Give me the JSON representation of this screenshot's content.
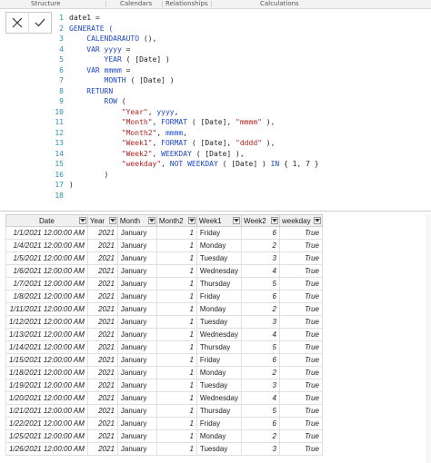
{
  "ribbon": {
    "sections": [
      "Structure",
      "Calendars",
      "Relationships",
      "Calculations"
    ]
  },
  "formula_bar": {
    "cancel_icon": "close-icon",
    "commit_icon": "checkmark-icon",
    "line_numbers": [
      "1",
      "2",
      "3",
      "4",
      "5",
      "6",
      "7",
      "8",
      "9",
      "10",
      "11",
      "12",
      "13",
      "14",
      "15",
      "16",
      "17",
      "18"
    ]
  },
  "code": [
    [
      {
        "t": "date1 =",
        "c": "txt"
      }
    ],
    [
      {
        "t": "GENERATE (",
        "c": "kw"
      }
    ],
    [
      {
        "t": "    ",
        "c": "txt"
      },
      {
        "t": "CALENDARAUTO",
        "c": "kw"
      },
      {
        "t": " (),",
        "c": "txt"
      }
    ],
    [
      {
        "t": "    ",
        "c": "txt"
      },
      {
        "t": "VAR",
        "c": "kw"
      },
      {
        "t": " ",
        "c": "txt"
      },
      {
        "t": "yyyy",
        "c": "kw"
      },
      {
        "t": " =",
        "c": "txt"
      }
    ],
    [
      {
        "t": "        ",
        "c": "txt"
      },
      {
        "t": "YEAR",
        "c": "kw"
      },
      {
        "t": " ( [Date] )",
        "c": "txt"
      }
    ],
    [
      {
        "t": "    ",
        "c": "txt"
      },
      {
        "t": "VAR",
        "c": "kw"
      },
      {
        "t": " ",
        "c": "txt"
      },
      {
        "t": "mmmm",
        "c": "kw"
      },
      {
        "t": " =",
        "c": "txt"
      }
    ],
    [
      {
        "t": "        ",
        "c": "txt"
      },
      {
        "t": "MONTH",
        "c": "kw"
      },
      {
        "t": " ( [Date] )",
        "c": "txt"
      }
    ],
    [
      {
        "t": "    ",
        "c": "txt"
      },
      {
        "t": "RETURN",
        "c": "kw"
      }
    ],
    [
      {
        "t": "        ",
        "c": "txt"
      },
      {
        "t": "ROW",
        "c": "kw"
      },
      {
        "t": " (",
        "c": "txt"
      }
    ],
    [
      {
        "t": "            ",
        "c": "txt"
      },
      {
        "t": "\"Year\"",
        "c": "str"
      },
      {
        "t": ", ",
        "c": "txt"
      },
      {
        "t": "yyyy",
        "c": "kw"
      },
      {
        "t": ",",
        "c": "txt"
      }
    ],
    [
      {
        "t": "            ",
        "c": "txt"
      },
      {
        "t": "\"Month\"",
        "c": "str"
      },
      {
        "t": ", ",
        "c": "txt"
      },
      {
        "t": "FORMAT",
        "c": "kw"
      },
      {
        "t": " ( [Date], ",
        "c": "txt"
      },
      {
        "t": "\"mmmm\"",
        "c": "str"
      },
      {
        "t": " ),",
        "c": "txt"
      }
    ],
    [
      {
        "t": "            ",
        "c": "txt"
      },
      {
        "t": "\"Month2\"",
        "c": "str"
      },
      {
        "t": ", ",
        "c": "txt"
      },
      {
        "t": "mmmm",
        "c": "kw"
      },
      {
        "t": ",",
        "c": "txt"
      }
    ],
    [
      {
        "t": "            ",
        "c": "txt"
      },
      {
        "t": "\"Week1\"",
        "c": "str"
      },
      {
        "t": ", ",
        "c": "txt"
      },
      {
        "t": "FORMAT",
        "c": "kw"
      },
      {
        "t": " ( [Date], ",
        "c": "txt"
      },
      {
        "t": "\"dddd\"",
        "c": "str"
      },
      {
        "t": " ),",
        "c": "txt"
      }
    ],
    [
      {
        "t": "            ",
        "c": "txt"
      },
      {
        "t": "\"Week2\"",
        "c": "str"
      },
      {
        "t": ", ",
        "c": "txt"
      },
      {
        "t": "WEEKDAY",
        "c": "kw"
      },
      {
        "t": " ( [Date] ),",
        "c": "txt"
      }
    ],
    [
      {
        "t": "            ",
        "c": "txt"
      },
      {
        "t": "\"weekday\"",
        "c": "str"
      },
      {
        "t": ", ",
        "c": "txt"
      },
      {
        "t": "NOT",
        "c": "kw"
      },
      {
        "t": " ",
        "c": "txt"
      },
      {
        "t": "WEEKDAY",
        "c": "kw"
      },
      {
        "t": " ( [Date] ) ",
        "c": "txt"
      },
      {
        "t": "IN",
        "c": "kw"
      },
      {
        "t": " { 1, 7 }",
        "c": "txt"
      }
    ],
    [
      {
        "t": "        )",
        "c": "txt"
      }
    ],
    [
      {
        "t": ")",
        "c": "txt"
      }
    ],
    [
      {
        "t": "",
        "c": "txt"
      }
    ]
  ],
  "table": {
    "columns": [
      "Date",
      "Year",
      "Month",
      "Month2",
      "Week1",
      "Week2",
      "weekday"
    ],
    "rows": [
      [
        "1/1/2021 12:00:00 AM",
        "2021",
        "January",
        "1",
        "Friday",
        "6",
        "True"
      ],
      [
        "1/4/2021 12:00:00 AM",
        "2021",
        "January",
        "1",
        "Monday",
        "2",
        "True"
      ],
      [
        "1/5/2021 12:00:00 AM",
        "2021",
        "January",
        "1",
        "Tuesday",
        "3",
        "True"
      ],
      [
        "1/6/2021 12:00:00 AM",
        "2021",
        "January",
        "1",
        "Wednesday",
        "4",
        "True"
      ],
      [
        "1/7/2021 12:00:00 AM",
        "2021",
        "January",
        "1",
        "Thursday",
        "5",
        "True"
      ],
      [
        "1/8/2021 12:00:00 AM",
        "2021",
        "January",
        "1",
        "Friday",
        "6",
        "True"
      ],
      [
        "1/11/2021 12:00:00 AM",
        "2021",
        "January",
        "1",
        "Monday",
        "2",
        "True"
      ],
      [
        "1/12/2021 12:00:00 AM",
        "2021",
        "January",
        "1",
        "Tuesday",
        "3",
        "True"
      ],
      [
        "1/13/2021 12:00:00 AM",
        "2021",
        "January",
        "1",
        "Wednesday",
        "4",
        "True"
      ],
      [
        "1/14/2021 12:00:00 AM",
        "2021",
        "January",
        "1",
        "Thursday",
        "5",
        "True"
      ],
      [
        "1/15/2021 12:00:00 AM",
        "2021",
        "January",
        "1",
        "Friday",
        "6",
        "True"
      ],
      [
        "1/18/2021 12:00:00 AM",
        "2021",
        "January",
        "1",
        "Monday",
        "2",
        "True"
      ],
      [
        "1/19/2021 12:00:00 AM",
        "2021",
        "January",
        "1",
        "Tuesday",
        "3",
        "True"
      ],
      [
        "1/20/2021 12:00:00 AM",
        "2021",
        "January",
        "1",
        "Wednesday",
        "4",
        "True"
      ],
      [
        "1/21/2021 12:00:00 AM",
        "2021",
        "January",
        "1",
        "Thursday",
        "5",
        "True"
      ],
      [
        "1/22/2021 12:00:00 AM",
        "2021",
        "January",
        "1",
        "Friday",
        "6",
        "True"
      ],
      [
        "1/25/2021 12:00:00 AM",
        "2021",
        "January",
        "1",
        "Monday",
        "2",
        "True"
      ],
      [
        "1/26/2021 12:00:00 AM",
        "2021",
        "January",
        "1",
        "Tuesday",
        "3",
        "True"
      ]
    ]
  }
}
